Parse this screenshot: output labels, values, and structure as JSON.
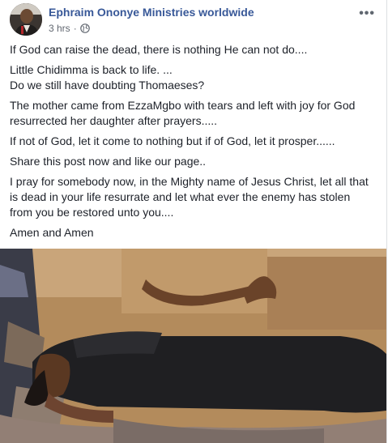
{
  "post": {
    "author": "Ephraim Ononye Ministries worldwide",
    "time": "3 hrs",
    "separator": "·",
    "privacy_icon": "globe-icon",
    "more_icon": "more-options-icon",
    "paragraphs": [
      {
        "lines": [
          "If God can raise the dead, there is nothing He can not do...."
        ]
      },
      {
        "lines": [
          "Little Chidimma is back to life. ...",
          "Do we still have doubting Thomaeses?"
        ]
      },
      {
        "lines": [
          "The mother came from EzzaMgbo with tears and left with joy for God",
          "resurrected her daughter after prayers....."
        ]
      },
      {
        "lines": [
          "If not of God, let it come to nothing but if of God, let it prosper......"
        ]
      },
      {
        "lines": [
          "Share this post now and like our page.."
        ]
      },
      {
        "lines": [
          "I pray for somebody now, in the Mighty name of Jesus Christ, let all that",
          "is dead in your life resurrate and let what ever the enemy has stolen",
          "from you be restored unto you...."
        ]
      },
      {
        "lines": [
          "Amen and Amen"
        ]
      }
    ]
  },
  "colors": {
    "author_link": "#385898",
    "meta_text": "#616770",
    "body_text": "#1d2129"
  }
}
